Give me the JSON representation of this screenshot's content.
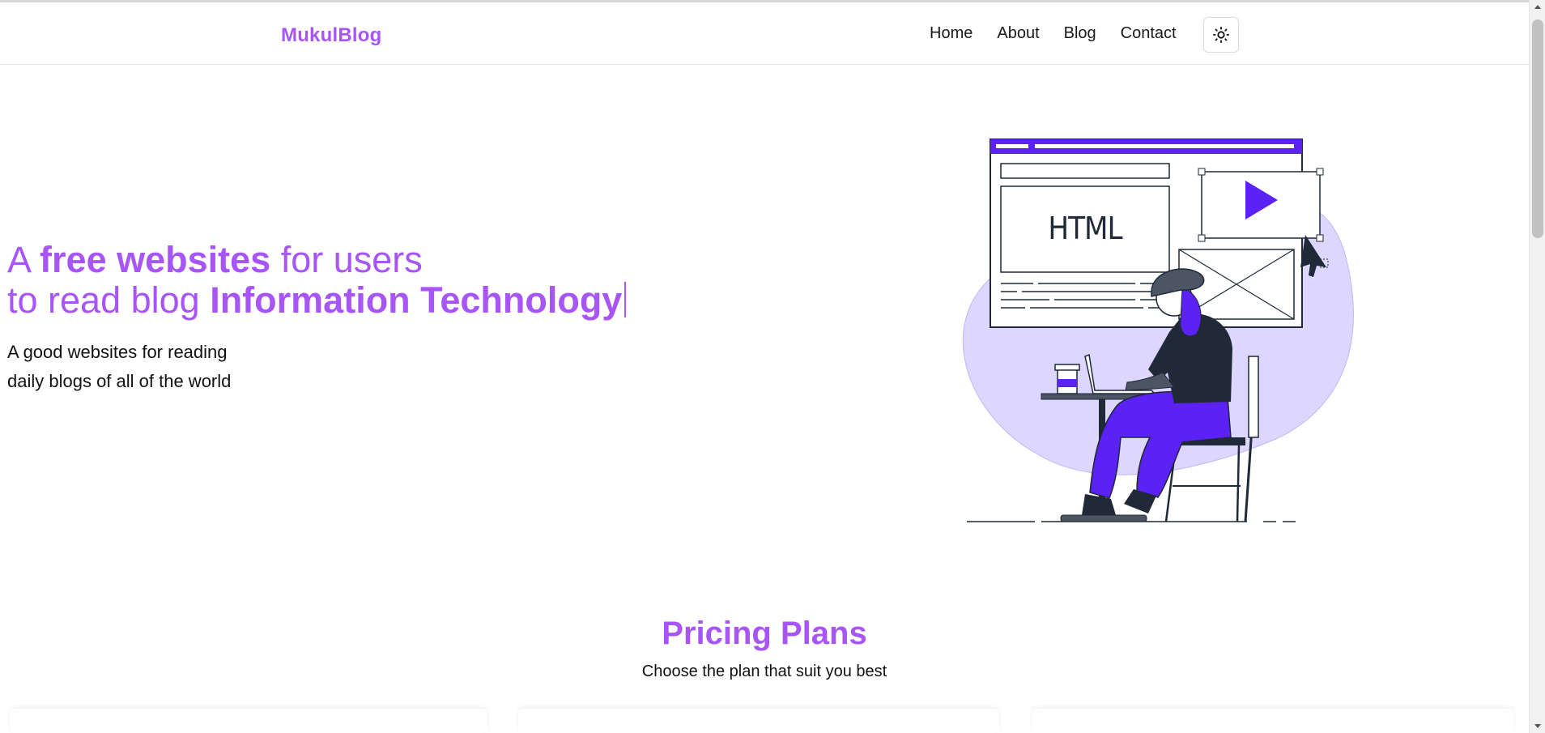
{
  "navbar": {
    "brand": "MukulBlog",
    "links": [
      "Home",
      "About",
      "Blog",
      "Contact"
    ],
    "theme_toggle_icon": "sun-icon"
  },
  "hero": {
    "line1_prefix": "A ",
    "line1_bold": "free websites",
    "line1_suffix": " for users",
    "line2_prefix": "to read blog ",
    "line2_bold": "Information Technology",
    "subtitle_line1": "A good websites for reading",
    "subtitle_line2": "daily blogs of all of the world",
    "illustration_code_label": "HTML",
    "accent_color": "#a855f7",
    "illustration_accent": "#5b21f5",
    "illustration_blob": "#ddd6fe"
  },
  "pricing": {
    "title": "Pricing Plans",
    "subtitle": "Choose the plan that suit you best"
  }
}
